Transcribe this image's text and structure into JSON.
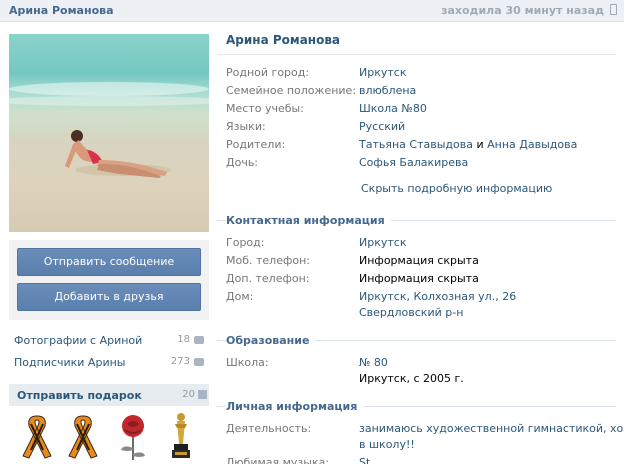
{
  "topbar": {
    "name": "Арина Романова",
    "status": "заходила 30 минут назад"
  },
  "left": {
    "send_message": "Отправить сообщение",
    "add_friend": "Добавить в друзья",
    "photos_link": "Фотографии с Ариной",
    "photos_count": "18",
    "subscribers_link": "Подписчики Арины",
    "subscribers_count": "273",
    "gifts_title": "Отправить подарок",
    "gifts_count": "20"
  },
  "profile": {
    "name": "Арина Романова",
    "rows": [
      {
        "label": "Родной город:",
        "value": "Иркутск"
      },
      {
        "label": "Семейное положение:",
        "value": "влюблена"
      },
      {
        "label": "Место учебы:",
        "value": "Школа №80"
      },
      {
        "label": "Языки:",
        "value": "Русский"
      },
      {
        "label": "Родители:",
        "value1": "Татьяна Ставыдова",
        "sep": " и ",
        "value2": "Анна Давыдова"
      },
      {
        "label": "Дочь:",
        "value": "Софья Балакирева"
      }
    ],
    "hide_link": "Скрыть подробную информацию"
  },
  "contacts": {
    "title": "Контактная информация",
    "city_label": "Город:",
    "city": "Иркутск",
    "mobile_label": "Моб. телефон:",
    "mobile": "Информация скрыта",
    "extra_label": "Доп. телефон:",
    "extra": "Информация скрыта",
    "home_label": "Дом:",
    "home_line1": "Иркутск, Колхозная ул., 26",
    "home_line2": "Свердловский р-н"
  },
  "education": {
    "title": "Образование",
    "school_label": "Школа:",
    "school": "№ 80",
    "school_detail": "Иркутск, с 2005 г."
  },
  "personal": {
    "title": "Личная информация",
    "activity_label": "Деятельность:",
    "activity_line1": "занимаюсь художественной гимнастикой, хожу",
    "activity_line2": "в школу!!",
    "music_label": "Любимая музыка:",
    "music": "St"
  }
}
